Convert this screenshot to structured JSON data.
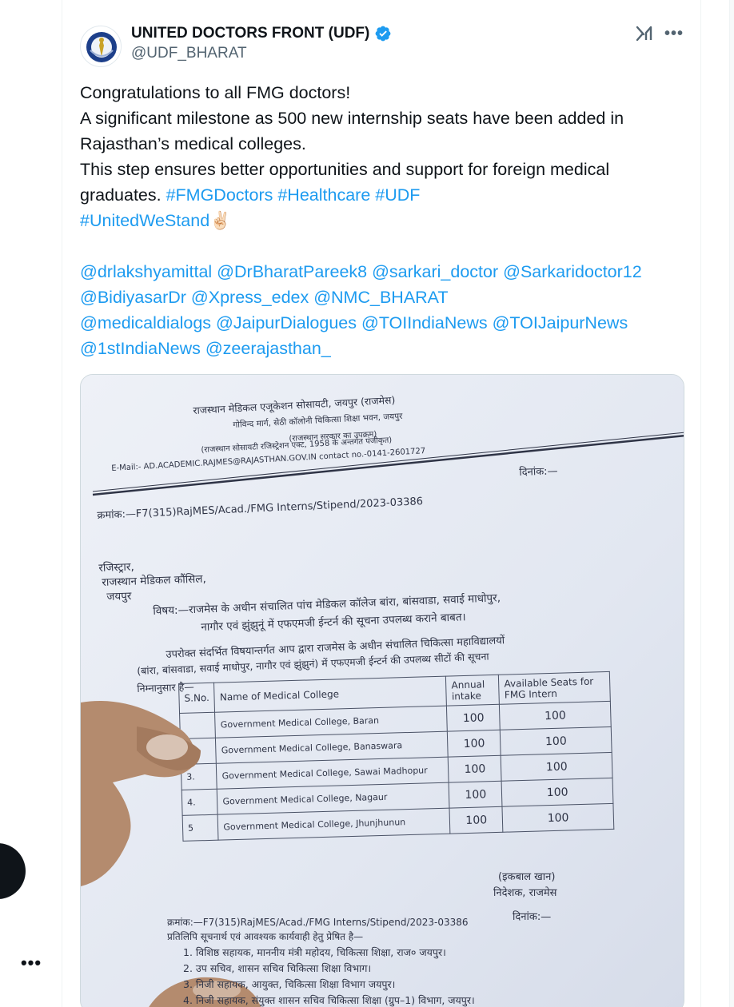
{
  "tweet": {
    "author": {
      "display_name": "UNITED DOCTORS FRONT (UDF)",
      "handle": "@UDF_BHARAT",
      "verified": true,
      "avatar_icon": "udf-emblem-icon"
    },
    "text_plain_1": "Congratulations to all FMG doctors!\nA significant milestone as 500 new internship seats have been added in Rajasthan’s medical colleges.\nThis step ensures better opportunities and support for foreign medical graduates. ",
    "hashtags_line": "#FMGDoctors #Healthcare #UDF\n#UnitedWeStand",
    "emoji": "✌🏻",
    "mentions": [
      "@drlakshyamittal @DrBharatPareek8 @sarkari_doctor @Sarkaridoctor12",
      "@BidiyasarDr @Xpress_edex @NMC_BHARAT",
      "@medicaldialogs @JaipurDialogues @TOIIndiaNews @TOIJaipurNews",
      "@1stIndiaNews @zeerajasthan_"
    ]
  },
  "icons": {
    "grok": "grok-icon",
    "more": "more-icon",
    "left_more": "•••",
    "more_glyph": "•••"
  },
  "colors": {
    "link": "#1d9bf0",
    "text": "#0f1419",
    "secondary": "#536471",
    "verified": "#1d9bf0"
  },
  "document": {
    "org_line1": "राजस्थान मेडिकल एजूकेशन सोसायटी, जयपुर (राजमेस)",
    "org_line2": "गोविन्द मार्ग, सेठी कॉलोनी चिकित्सा शिक्षा भवन, जयपुर",
    "org_line3": "(राजस्थान सरकार का उपक्रम)",
    "org_line4": "(राजस्थान सोसायटी रजिस्ट्रेशन एक्ट, 1958 के अन्तर्गत पंजीकृत)",
    "email_line": "E-Mail:- AD.ACADEMIC.RAJMES@RAJASTHAN.GOV.IN contact no.-0141-2601727",
    "date_label": "दिनांक:—",
    "ref_no": "क्रमांक:—F7(315)RajMES/Acad./FMG Interns/Stipend/2023-03386",
    "addr1": "रजिस्ट्रार,",
    "addr2": "राजस्थान मेडिकल कौंसिल,",
    "addr3": "जयपुर",
    "subject1": "विषय:—राजमेस के अधीन संचालित पांच मेडिकल कॉलेज बांरा, बांसवाडा, सवाई माधोपुर,",
    "subject2": "नागौर एवं झुंझुनूं में एफएमजी ईन्टर्न की सूचना उपलब्ध कराने बाबत।",
    "body1": "उपरोक्त संदर्भित विषयान्तर्गत आप द्वारा राजमेस के अधीन संचालित चिकित्सा महाविद्यालयों",
    "body2": "(बांरा, बांसवाडा, सवाई माधोपुर, नागौर एवं झुंझुनं) में एफएमजी ईन्टर्न की उपलब्ध सीटों की सूचना",
    "body3": "निम्नानुसार है—",
    "table": {
      "headers": [
        "S.No.",
        "Name of Medical College",
        "Annual intake",
        "Available Seats for FMG Intern"
      ],
      "rows": [
        [
          "",
          "Government Medical College, Baran",
          "100",
          "100"
        ],
        [
          "",
          "Government Medical College, Banaswara",
          "100",
          "100"
        ],
        [
          "3.",
          "Government Medical College, Sawai Madhopur",
          "100",
          "100"
        ],
        [
          "4.",
          "Government Medical College, Nagaur",
          "100",
          "100"
        ],
        [
          "5",
          "Government Medical College, Jhunjhunun",
          "100",
          "100"
        ]
      ]
    },
    "sign1": "(इकबाल खान)",
    "sign2": "निदेशक, राजमेस",
    "ref_no2": "क्रमांक:—F7(315)RajMES/Acad./FMG Interns/Stipend/2023-03386",
    "date_label2": "दिनांक:—",
    "copy_line": "प्रतिलिपि सूचनार्थ एवं आवश्यक कार्यवाही हेतु प्रेषित है—",
    "copies": [
      "1. विशिष्ठ सहायक, माननीय मंत्री महोदय, चिकित्सा शिक्षा, राज० जयपुर।",
      "2. उप सचिव, शासन सचिव चिकित्सा शिक्षा विभाग।",
      "3. निजी सहायक, आयुक्त, चिकित्सा शिक्षा विभाग जयपुर।",
      "4. निजी सहायक, संयुक्त शासन सचिव चिकित्सा शिक्षा (ग्रुप–1) विभाग, जयपुर।"
    ]
  }
}
